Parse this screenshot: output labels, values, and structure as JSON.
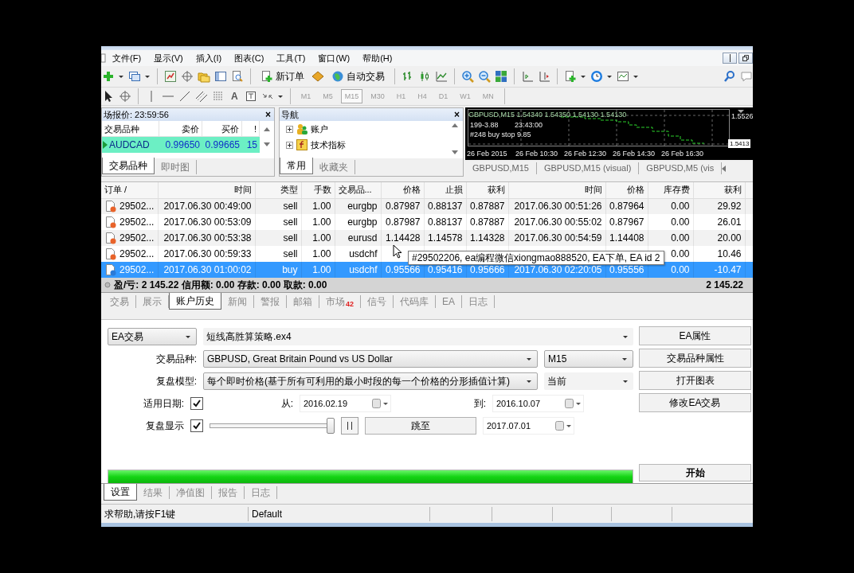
{
  "menu": [
    "文件(F)",
    "显示(V)",
    "插入(I)",
    "图表(C)",
    "工具(T)",
    "窗口(W)",
    "帮助(H)"
  ],
  "toolbar": {
    "buttons": [
      "新订单",
      "自动交易"
    ],
    "text_tool": "A",
    "timeframes": [
      {
        "label": "M1",
        "selected": false
      },
      {
        "label": "M5",
        "selected": false
      },
      {
        "label": "M15",
        "selected": true
      },
      {
        "label": "M30",
        "selected": false
      },
      {
        "label": "H1",
        "selected": false
      },
      {
        "label": "H4",
        "selected": false
      },
      {
        "label": "D1",
        "selected": false
      },
      {
        "label": "W1",
        "selected": false
      },
      {
        "label": "MN",
        "selected": false
      }
    ]
  },
  "market_watch": {
    "title": "场报价: 23:59:56",
    "close": "×",
    "columns": [
      "交易品种",
      "卖价",
      "买价",
      "!"
    ],
    "rows": [
      {
        "symbol": "AUDCAD",
        "bid": "0.99650",
        "ask": "0.99665",
        "spread": "15",
        "selected": true
      }
    ],
    "tabs": [
      {
        "label": "交易品种",
        "selected": true
      },
      {
        "label": "即时图",
        "selected": false
      }
    ]
  },
  "navigator": {
    "title": "导航",
    "close": "×",
    "items": [
      {
        "label": "账户",
        "kind": "accounts"
      },
      {
        "label": "技术指标",
        "kind": "indicators"
      }
    ],
    "tabs": [
      {
        "label": "常用",
        "selected": true
      },
      {
        "label": "收藏夹",
        "selected": false
      }
    ]
  },
  "chart": {
    "header": "GBPUSD,M15 1.54340 1.54350 1.54130 1.54130",
    "info": [
      [
        "199-3.88",
        "23:43:00"
      ],
      [
        "#248 buy stop 9.85"
      ]
    ],
    "price_labels": [
      "1.5526",
      "1.5413"
    ],
    "time_labels": [
      "26 Feb 2015",
      "26 Feb 10:30",
      "26 Feb 12:30",
      "26 Feb 14:30",
      "26 Feb 16:30"
    ],
    "tabs": [
      "GBPUSD,M15",
      "GBPUSD,M15 (visual)",
      "GBPUSD,M5 (vis"
    ]
  },
  "terminal": {
    "columns": [
      "订单 /",
      "时间",
      "类型",
      "手数",
      "交易品...",
      "价格",
      "止损",
      "获利",
      "时间",
      "价格",
      "库存费",
      "获利"
    ],
    "rows": [
      {
        "kind": "sell",
        "selected": false,
        "order": "29502...",
        "open_time": "2017.06.30 00:49:00",
        "type": "sell",
        "lots": "1.00",
        "symbol": "eurgbp",
        "price": "0.87987",
        "sl": "0.88137",
        "tp": "0.87887",
        "close_time": "2017.06.30 00:51:26",
        "close_price": "0.87964",
        "swap": "0.00",
        "profit": "29.92"
      },
      {
        "kind": "sell",
        "selected": false,
        "order": "29502...",
        "open_time": "2017.06.30 00:53:09",
        "type": "sell",
        "lots": "1.00",
        "symbol": "eurgbp",
        "price": "0.87987",
        "sl": "0.88137",
        "tp": "0.87887",
        "close_time": "2017.06.30 00:55:02",
        "close_price": "0.87967",
        "swap": "0.00",
        "profit": "26.01"
      },
      {
        "kind": "sell",
        "selected": false,
        "order": "29502...",
        "open_time": "2017.06.30 00:53:38",
        "type": "sell",
        "lots": "1.00",
        "symbol": "eurusd",
        "price": "1.14428",
        "sl": "1.14578",
        "tp": "1.14328",
        "close_time": "2017.06.30 00:54:59",
        "close_price": "1.14408",
        "swap": "0.00",
        "profit": "20.00"
      },
      {
        "kind": "sell",
        "selected": false,
        "order": "29502...",
        "open_time": "2017.06.30 00:59:33",
        "type": "sell",
        "lots": "1.00",
        "symbol": "usdchf",
        "swap": "0.00",
        "profit": "10.46"
      },
      {
        "kind": "buy",
        "selected": true,
        "order": "29502...",
        "open_time": "2017.06.30 01:00:02",
        "type": "buy",
        "lots": "1.00",
        "symbol": "usdchf",
        "price": "0.95566",
        "sl": "0.95416",
        "tp": "0.95666",
        "close_time": "2017.06.30 02:20:05",
        "close_price": "0.95556",
        "swap": "0.00",
        "profit": "-10.47"
      }
    ],
    "summary": "盈/亏: 2 145.22 信用额: 0.00 存款: 0.00 取款: 0.00",
    "total": "2 145.22",
    "tooltip": "#29502206, ea编程微信xiongmao888520, EA下单, EA id 2",
    "tabs": [
      {
        "label": "交易",
        "selected": false
      },
      {
        "label": "展示",
        "selected": false
      },
      {
        "label": "账户历史",
        "selected": true
      },
      {
        "label": "新闻",
        "selected": false
      },
      {
        "label": "警报",
        "selected": false
      },
      {
        "label": "邮箱",
        "selected": false
      },
      {
        "label": "市场",
        "badge": "42",
        "selected": false
      },
      {
        "label": "信号",
        "selected": false
      },
      {
        "label": "代码库",
        "selected": false
      },
      {
        "label": "EA",
        "selected": false
      },
      {
        "label": "日志",
        "selected": false
      }
    ]
  },
  "tester": {
    "mode": "EA交易",
    "expert": "短线高胜算策略.ex4",
    "symbol_label": "交易品种:",
    "symbol": "GBPUSD, Great Britain Pound vs US Dollar",
    "period": "M15",
    "model_label": "复盘模型:",
    "model": "每个即时价格(基于所有可利用的最小时段的每一个价格的分形插值计算)",
    "spread": "当前",
    "date_label": "适用日期:",
    "use_date": true,
    "from_label": "从:",
    "from": "2016.02.19",
    "to_label": "到:",
    "to": "2016.10.07",
    "visual_label": "复盘显示",
    "visual": true,
    "speed": {
      "level": 1
    },
    "skip_button": "跳至",
    "skip_to": "2017.07.01",
    "progress": {
      "level": 1
    },
    "buttons": [
      "EA属性",
      "交易品种属性",
      "打开图表",
      "修改EA交易"
    ],
    "start": "开始",
    "tabs": [
      {
        "label": "设置",
        "selected": true
      },
      {
        "label": "结果",
        "selected": false
      },
      {
        "label": "净值图",
        "selected": false
      },
      {
        "label": "报告",
        "selected": false
      },
      {
        "label": "日志",
        "selected": false
      }
    ]
  },
  "status_bar": [
    "求帮助,请按F1键",
    "Default"
  ]
}
